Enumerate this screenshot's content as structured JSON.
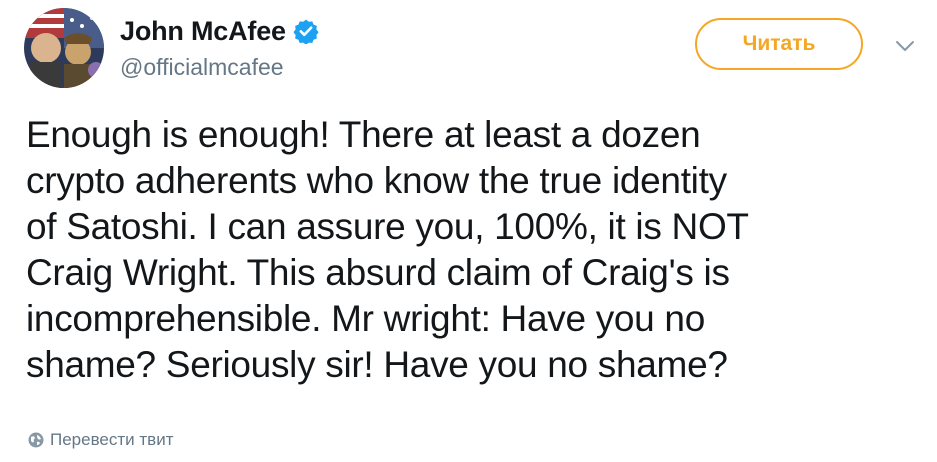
{
  "author": {
    "display_name": "John McAfee",
    "handle": "@officialmcafee",
    "verified": true,
    "avatar_icon": "profile-photo"
  },
  "actions": {
    "follow_label": "Читать",
    "menu_icon": "chevron-down-icon"
  },
  "tweet": {
    "text": "Enough is enough! There at least a dozen\ncrypto adherents who know the true identity\nof Satoshi. I can assure you, 100%, it is NOT\nCraig Wright. This absurd claim of Craig's is\nincomprehensible. Mr wright: Have you no\nshame? Seriously sir! Have you no shame?"
  },
  "translate": {
    "label": "Перевести твит",
    "icon": "globe-icon"
  },
  "colors": {
    "follow_accent": "#f5a623",
    "verified_blue": "#1da1f2",
    "secondary_text": "#657786",
    "primary_text": "#14171a"
  }
}
